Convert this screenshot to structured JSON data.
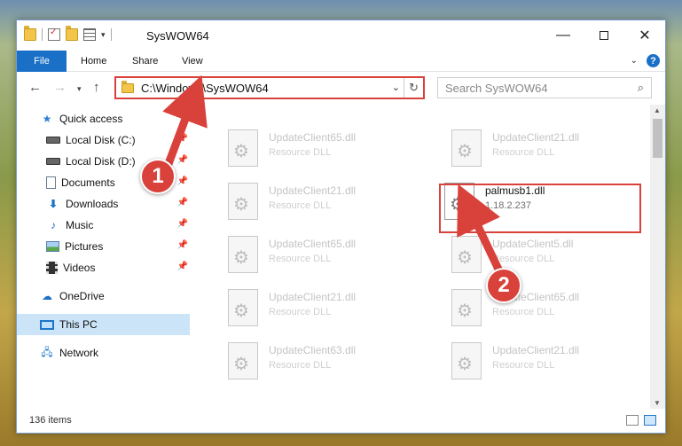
{
  "window": {
    "title": "SysWOW64",
    "minimize_glyph": "—",
    "close_glyph": "✕"
  },
  "ribbon": {
    "tabs": [
      {
        "label": "File"
      },
      {
        "label": "Home"
      },
      {
        "label": "Share"
      },
      {
        "label": "View"
      }
    ],
    "help_glyph": "?",
    "accent_color": "#1a70c7"
  },
  "nav": {
    "address_path": "C:\\Windows\\SysWOW64",
    "search_placeholder": "Search SysWOW64"
  },
  "sidebar": {
    "items": [
      {
        "label": "Quick access",
        "icon": "star-icon",
        "pinned": false
      },
      {
        "label": "Local Disk (C:)",
        "icon": "disk-icon",
        "pinned": true
      },
      {
        "label": "Local Disk (D:)",
        "icon": "disk-icon",
        "pinned": true
      },
      {
        "label": "Documents",
        "icon": "documents-icon",
        "pinned": true
      },
      {
        "label": "Downloads",
        "icon": "downloads-icon",
        "pinned": true
      },
      {
        "label": "Music",
        "icon": "music-icon",
        "pinned": true
      },
      {
        "label": "Pictures",
        "icon": "pictures-icon",
        "pinned": true
      },
      {
        "label": "Videos",
        "icon": "videos-icon",
        "pinned": true
      },
      {
        "label": "OneDrive",
        "icon": "onedrive-icon",
        "pinned": false
      },
      {
        "label": "This PC",
        "icon": "this-pc-icon",
        "pinned": false,
        "selected": true
      },
      {
        "label": "Network",
        "icon": "network-icon",
        "pinned": false
      }
    ]
  },
  "files": [
    {
      "name": "UpdateClient65.dll",
      "type": "Resource DLL"
    },
    {
      "name": "UpdateClient21.dll",
      "type": "Resource DLL"
    },
    {
      "name": "UpdateClient21.dll",
      "type": "Resource DLL"
    },
    {
      "name": "palmusb1.dll",
      "type": "1.18.2.237",
      "highlighted": true
    },
    {
      "name": "UpdateClient65.dll",
      "type": "Resource DLL"
    },
    {
      "name": "UpdateClient5.dll",
      "type": "Resource DLL"
    },
    {
      "name": "UpdateClient21.dll",
      "type": "Resource DLL"
    },
    {
      "name": "UpdateClient65.dll",
      "type": "Resource DLL"
    },
    {
      "name": "UpdateClient63.dll",
      "type": "Resource DLL"
    },
    {
      "name": "UpdateClient21.dll",
      "type": "Resource DLL"
    }
  ],
  "status": {
    "item_count": "136 items"
  },
  "annotations": [
    {
      "label": "1",
      "color": "#d9413b"
    },
    {
      "label": "2",
      "color": "#d9413b"
    }
  ]
}
